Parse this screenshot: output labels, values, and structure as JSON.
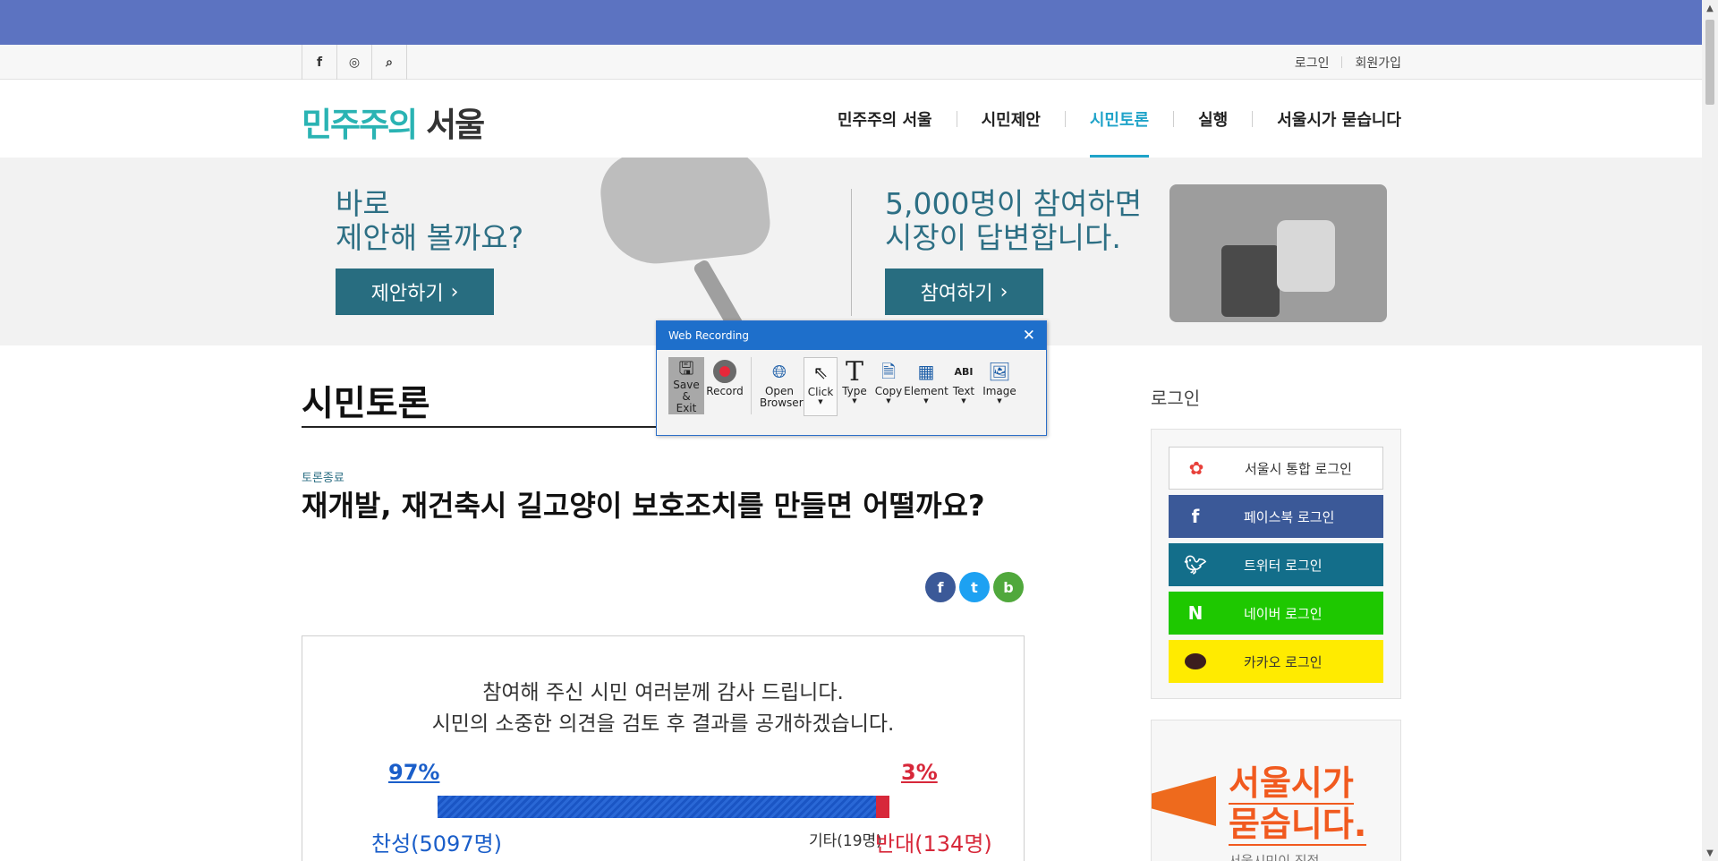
{
  "util": {
    "social": [
      "f",
      "◎",
      "⌕"
    ],
    "login": "로그인",
    "signup": "회원가입"
  },
  "logo": {
    "part_a": "민주주의",
    "part_b": "서울"
  },
  "nav": [
    "민주주의 서울",
    "시민제안",
    "시민토론",
    "실행",
    "서울시가 묻습니다"
  ],
  "banner": {
    "left_line1": "바로",
    "left_line2": "제안해 볼까요?",
    "left_button": "제안하기",
    "right_line1": "5,000명이 참여하면",
    "right_line2": "시장이 답변합니다.",
    "right_button": "참여하기"
  },
  "main": {
    "page_title": "시민토론",
    "status": "토론종료",
    "headline": "재개발, 재건축시 길고양이 보호조치를 만들면 어떨까요?",
    "share": [
      "f",
      "t",
      "b"
    ]
  },
  "result": {
    "thanks_line1": "참여해 주신 시민 여러분께 감사 드립니다.",
    "thanks_line2": "시민의 소중한 의견을 검토 후 결과를 공개하겠습니다.",
    "for_pct": "97%",
    "against_pct": "3%",
    "for_fraction": 0.97,
    "for_label": "찬성(5097명)",
    "etc_label": "기타(19명)",
    "against_label": "반대(134명)"
  },
  "sidebar": {
    "login_title": "로그인",
    "logins": [
      {
        "label": "서울시 통합 로그인",
        "icon": "seoul-logo-icon",
        "bg": "#ffffff",
        "color": "#333333"
      },
      {
        "label": "페이스북 로그인",
        "icon": "facebook-icon",
        "bg": "#3b5998",
        "color": "#ffffff"
      },
      {
        "label": "트위터 로그인",
        "icon": "twitter-icon",
        "bg": "#136e8a",
        "color": "#ffffff"
      },
      {
        "label": "네이버 로그인",
        "icon": "naver-icon",
        "bg": "#1ec800",
        "color": "#ffffff"
      },
      {
        "label": "카카오 로그인",
        "icon": "kakao-icon",
        "bg": "#ffeb00",
        "color": "#333333"
      }
    ],
    "promo_line1": "서울시가",
    "promo_line2": "묻습니다.",
    "promo_sub": "서울시민이 직접"
  },
  "web_recording": {
    "title": "Web Recording",
    "tools": {
      "save": "Save & Exit",
      "record": "Record",
      "open_browser": "Open Browser",
      "click": "Click",
      "type": "Type",
      "copy": "Copy",
      "element": "Element",
      "text": "Text",
      "image": "Image"
    }
  },
  "colors": {
    "top_bar": "#5c73c1",
    "brand_teal": "#2ab3b3",
    "nav_active": "#1fa3c9",
    "button_teal": "#286d80",
    "vote_for": "#1a5ec9",
    "vote_against": "#d7283a"
  }
}
